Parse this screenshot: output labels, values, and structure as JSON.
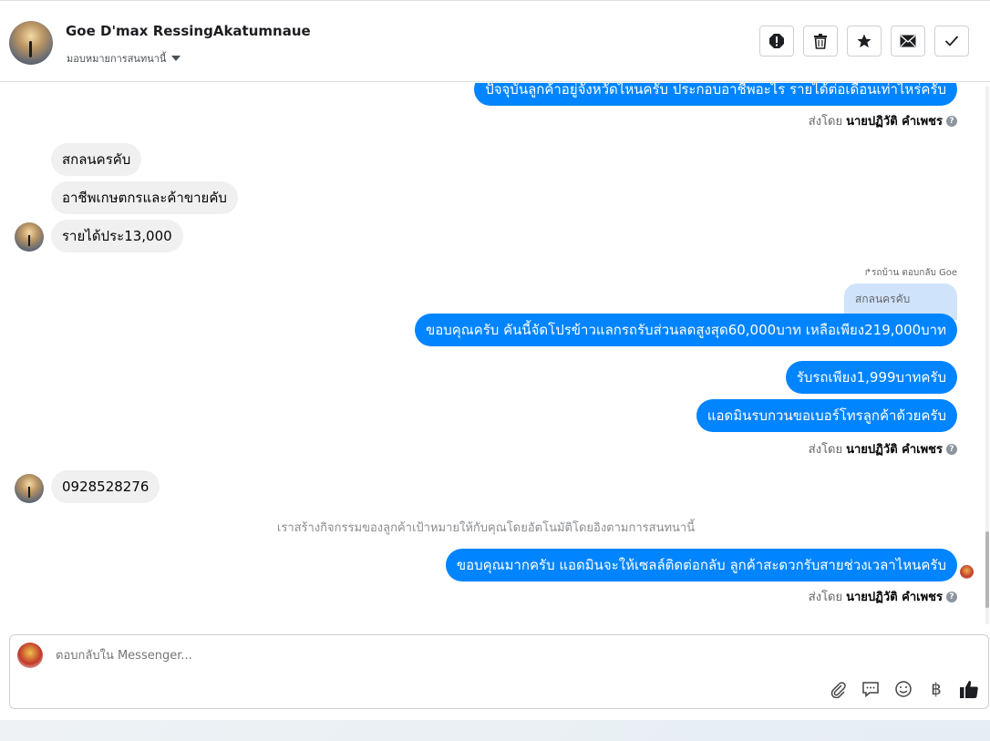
{
  "header": {
    "contact_name": "Goe D'max RessingAkatumnaue",
    "assign_label": "มอบหมายการสนทนานี้",
    "toolbar": [
      {
        "icon": "alert-icon"
      },
      {
        "icon": "trash-icon"
      },
      {
        "icon": "star-icon"
      },
      {
        "icon": "envelope-icon"
      },
      {
        "icon": "check-icon"
      }
    ]
  },
  "messages": {
    "out_top": "ปัจจุบันลูกค้าอยู่จังหวัดไหนครับ ประกอบอาชีพอะไร รายได้ต่อเดือนเท่าไหร่ครับ",
    "sent_by_prefix": "ส่งโดย",
    "sent_by_name": "นายปฏิวัติ คำเพชร",
    "help_mark": "?",
    "in_1": "สกลนครคับ",
    "in_2": "อาชีพเกษตกรและค้าขายคับ",
    "in_3": "รายได้ประ13,000",
    "reply_note": "↱รถบ้าน ตอบกลับ Goe",
    "reply_quote": "สกลนครคับ",
    "out_2": "ขอบคุณครับ คันนี้จัดโปรข้าวแลกรถรับส่วนลดสูงสุด60,000บาท เหลือเพียง219,000บาท",
    "out_3": "รับรถเพียง1,999บาทครับ",
    "out_4": "แอดมินรบกวนขอเบอร์โทรลูกค้าด้วยครับ",
    "in_4": "0928528276",
    "system_note": "เราสร้างกิจกรรมของลูกค้าเป้าหมายให้กับคุณโดยอัตโนมัติโดยอิงตามการสนทนานี้",
    "out_5": "ขอบคุณมากครับ แอดมินจะให้เซลล์ติดต่อกลับ ลูกค้าสะดวกรับสายช่วงเวลาไหนครับ"
  },
  "composer": {
    "placeholder": "ตอบกลับใน Messenger...",
    "tools": [
      "paperclip-icon",
      "comment-icon",
      "smiley-icon",
      "baht-icon",
      "thumbs-up-icon"
    ],
    "baht_symbol": "฿"
  },
  "colors": {
    "outgoing_bubble": "#0084ff",
    "incoming_bubble": "#f0f0f0",
    "reply_quote_bg": "#cfe3fb"
  }
}
